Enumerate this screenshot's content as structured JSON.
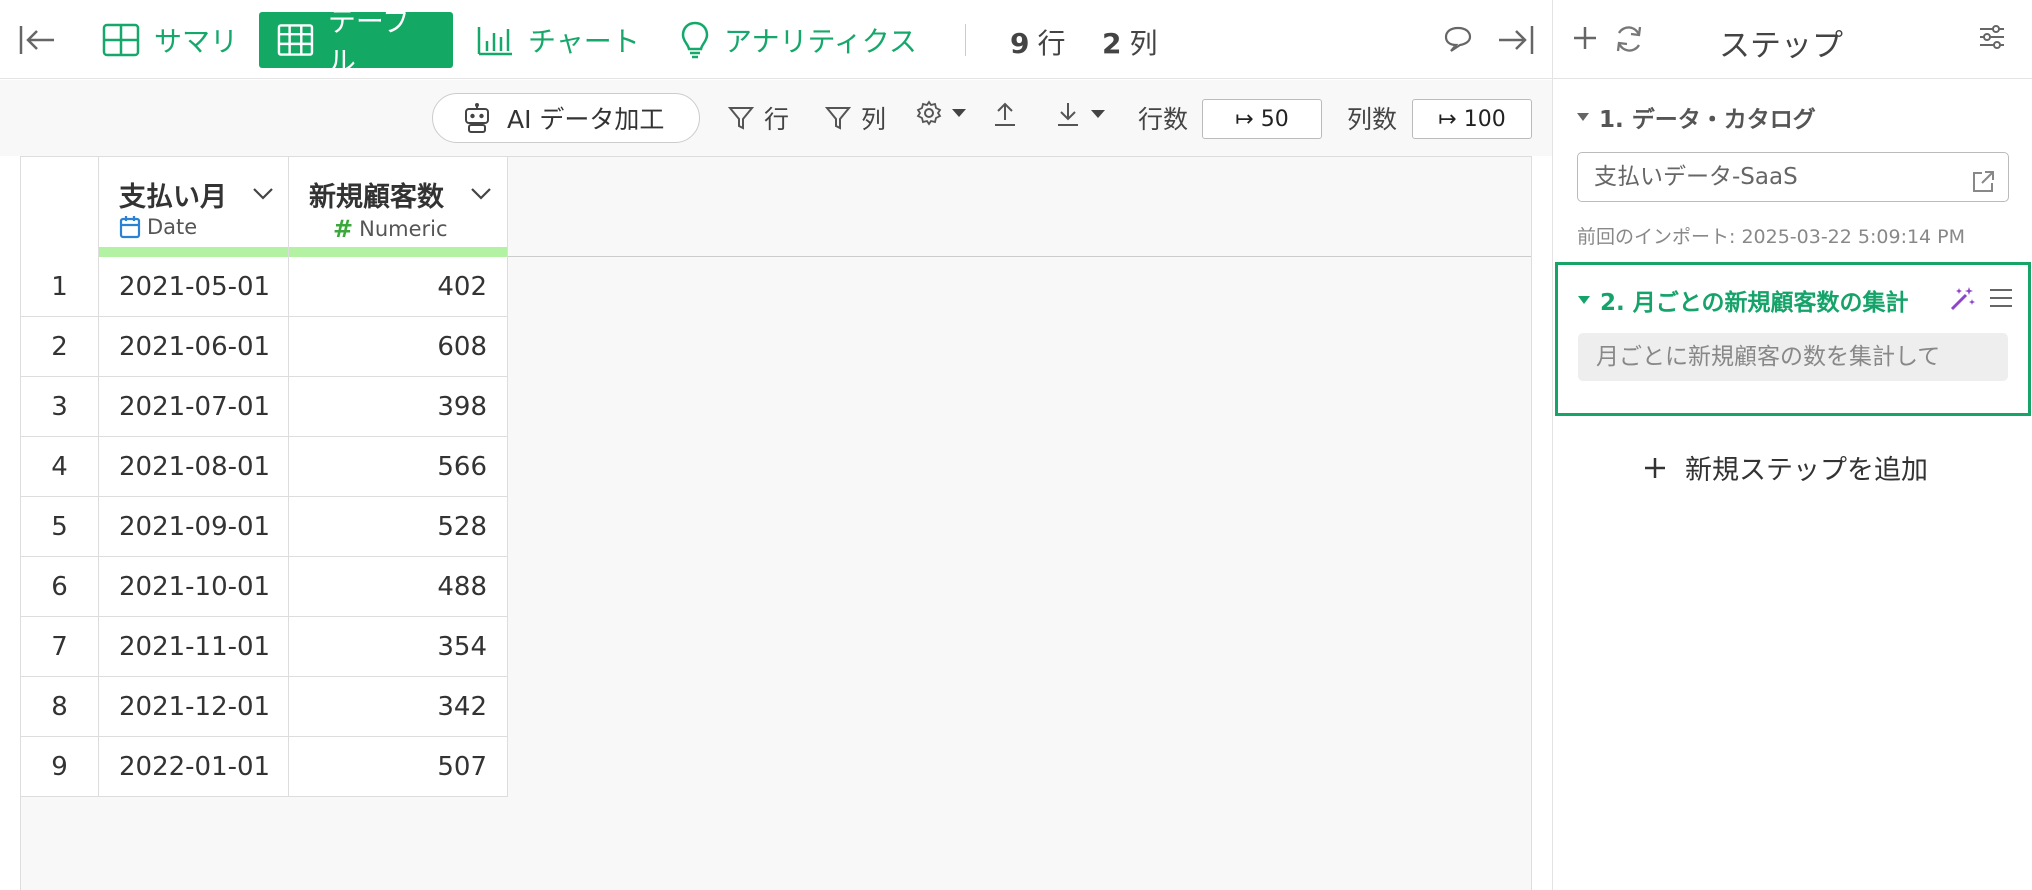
{
  "topbar": {
    "tabs": [
      {
        "label": "サマリ",
        "icon": "summary-grid-icon"
      },
      {
        "label": "テーブル",
        "icon": "table-icon",
        "active": true
      },
      {
        "label": "チャート",
        "icon": "bar-chart-icon"
      },
      {
        "label": "アナリティクス",
        "icon": "lightbulb-icon"
      }
    ],
    "rows_count": "9",
    "rows_unit": "行",
    "cols_count": "2",
    "cols_unit": "列"
  },
  "toolbar": {
    "ai_label": "AI データ加工",
    "row_filter_label": "行",
    "col_filter_label": "列",
    "row_limit_label": "行数",
    "row_limit_value": "↦ 50",
    "col_limit_label": "列数",
    "col_limit_value": "↦ 100"
  },
  "table": {
    "columns": [
      {
        "name": "支払い月",
        "type": "Date",
        "type_icon": "calendar-icon"
      },
      {
        "name": "新規顧客数",
        "type": "Numeric",
        "type_icon": "hash-icon"
      }
    ],
    "rows": [
      {
        "idx": "1",
        "date": "2021-05-01",
        "value": "402"
      },
      {
        "idx": "2",
        "date": "2021-06-01",
        "value": "608"
      },
      {
        "idx": "3",
        "date": "2021-07-01",
        "value": "398"
      },
      {
        "idx": "4",
        "date": "2021-08-01",
        "value": "566"
      },
      {
        "idx": "5",
        "date": "2021-09-01",
        "value": "528"
      },
      {
        "idx": "6",
        "date": "2021-10-01",
        "value": "488"
      },
      {
        "idx": "7",
        "date": "2021-11-01",
        "value": "354"
      },
      {
        "idx": "8",
        "date": "2021-12-01",
        "value": "342"
      },
      {
        "idx": "9",
        "date": "2022-01-01",
        "value": "507"
      }
    ]
  },
  "panel": {
    "title": "ステップ",
    "step1": {
      "title": "1. データ・カタログ",
      "source": "支払いデータ-SaaS",
      "import_note": "前回のインポート: 2025-03-22 5:09:14 PM"
    },
    "step2": {
      "title": "2. 月ごとの新規顧客数の集計",
      "description": "月ごとに新規顧客の数を集計して"
    },
    "add_step_label": "新規ステップを追加"
  },
  "colors": {
    "accent": "#14a865",
    "type_bar": "#b2f2a2",
    "wand": "#8e44c9"
  }
}
